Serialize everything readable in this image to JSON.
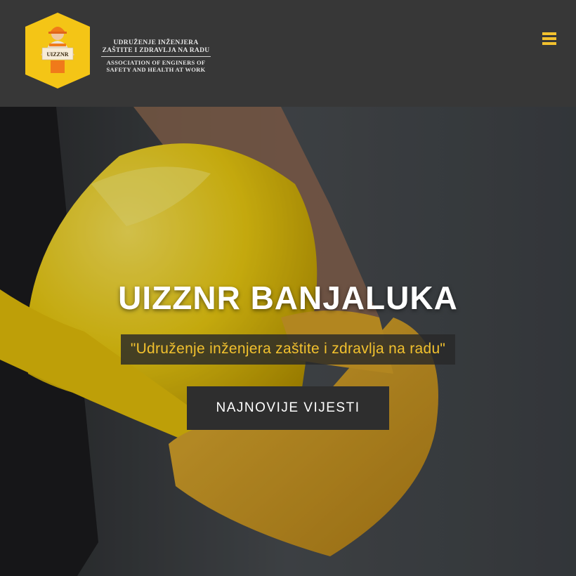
{
  "header": {
    "logo_badge_text": "UIZZNR",
    "logo_line_1": "UDRUŽENJE INŽENJERA",
    "logo_line_2": "ZAŠTITE I ZDRAVLJA NA RADU",
    "logo_line_3": "ASSOCIATION OF ENGINERS OF",
    "logo_line_4": "SAFETY AND HEALTH AT WORK",
    "menu_icon": "hamburger-menu-icon"
  },
  "hero": {
    "title": "UIZZNR BANJALUKA",
    "subtitle": "\"Udruženje inženjera zaštite i zdravlja na radu\"",
    "cta_label": "NAJNOVIJE VIJESTI"
  },
  "colors": {
    "header_bg": "#373737",
    "accent_yellow": "#f2c12e",
    "button_bg": "#2e2e2e",
    "title_text": "#ffffff"
  }
}
